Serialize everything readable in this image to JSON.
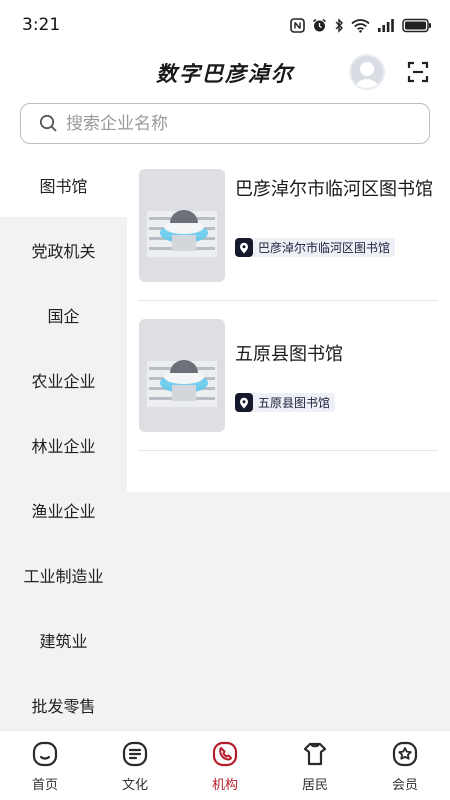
{
  "status_bar": {
    "time": "3:21",
    "icons": [
      "nfc-icon",
      "alarm-icon",
      "bluetooth-icon",
      "wifi-icon",
      "signal-icon",
      "battery-icon"
    ]
  },
  "header": {
    "title": "数字巴彦淖尔",
    "avatar_icon": "avatar-icon",
    "scan_icon": "scan-icon"
  },
  "search": {
    "placeholder": "搜索企业名称",
    "value": ""
  },
  "sidebar": {
    "items": [
      {
        "label": "图书馆",
        "active": true
      },
      {
        "label": "党政机关",
        "active": false
      },
      {
        "label": "国企",
        "active": false
      },
      {
        "label": "农业企业",
        "active": false
      },
      {
        "label": "林业企业",
        "active": false
      },
      {
        "label": "渔业企业",
        "active": false
      },
      {
        "label": "工业制造业",
        "active": false
      },
      {
        "label": "建筑业",
        "active": false
      },
      {
        "label": "批发零售",
        "active": false
      }
    ]
  },
  "libraries": [
    {
      "title": "巴彦淖尔市临河区图书馆",
      "tag": "巴彦淖尔市临河区图书馆",
      "icon": "location-pin-icon"
    },
    {
      "title": "五原县图书馆",
      "tag": "五原县图书馆",
      "icon": "location-pin-icon"
    }
  ],
  "tabbar": {
    "items": [
      {
        "label": "首页",
        "icon": "home-icon",
        "active": false
      },
      {
        "label": "文化",
        "icon": "culture-icon",
        "active": false
      },
      {
        "label": "机构",
        "icon": "institution-icon",
        "active": true
      },
      {
        "label": "居民",
        "icon": "resident-icon",
        "active": false
      },
      {
        "label": "会员",
        "icon": "member-icon",
        "active": false
      }
    ]
  },
  "colors": {
    "accent": "#b41f2b",
    "sidebar_bg": "#f2f2f2",
    "tag_bg": "#eef0f6",
    "tag_pin": "#16192c"
  }
}
